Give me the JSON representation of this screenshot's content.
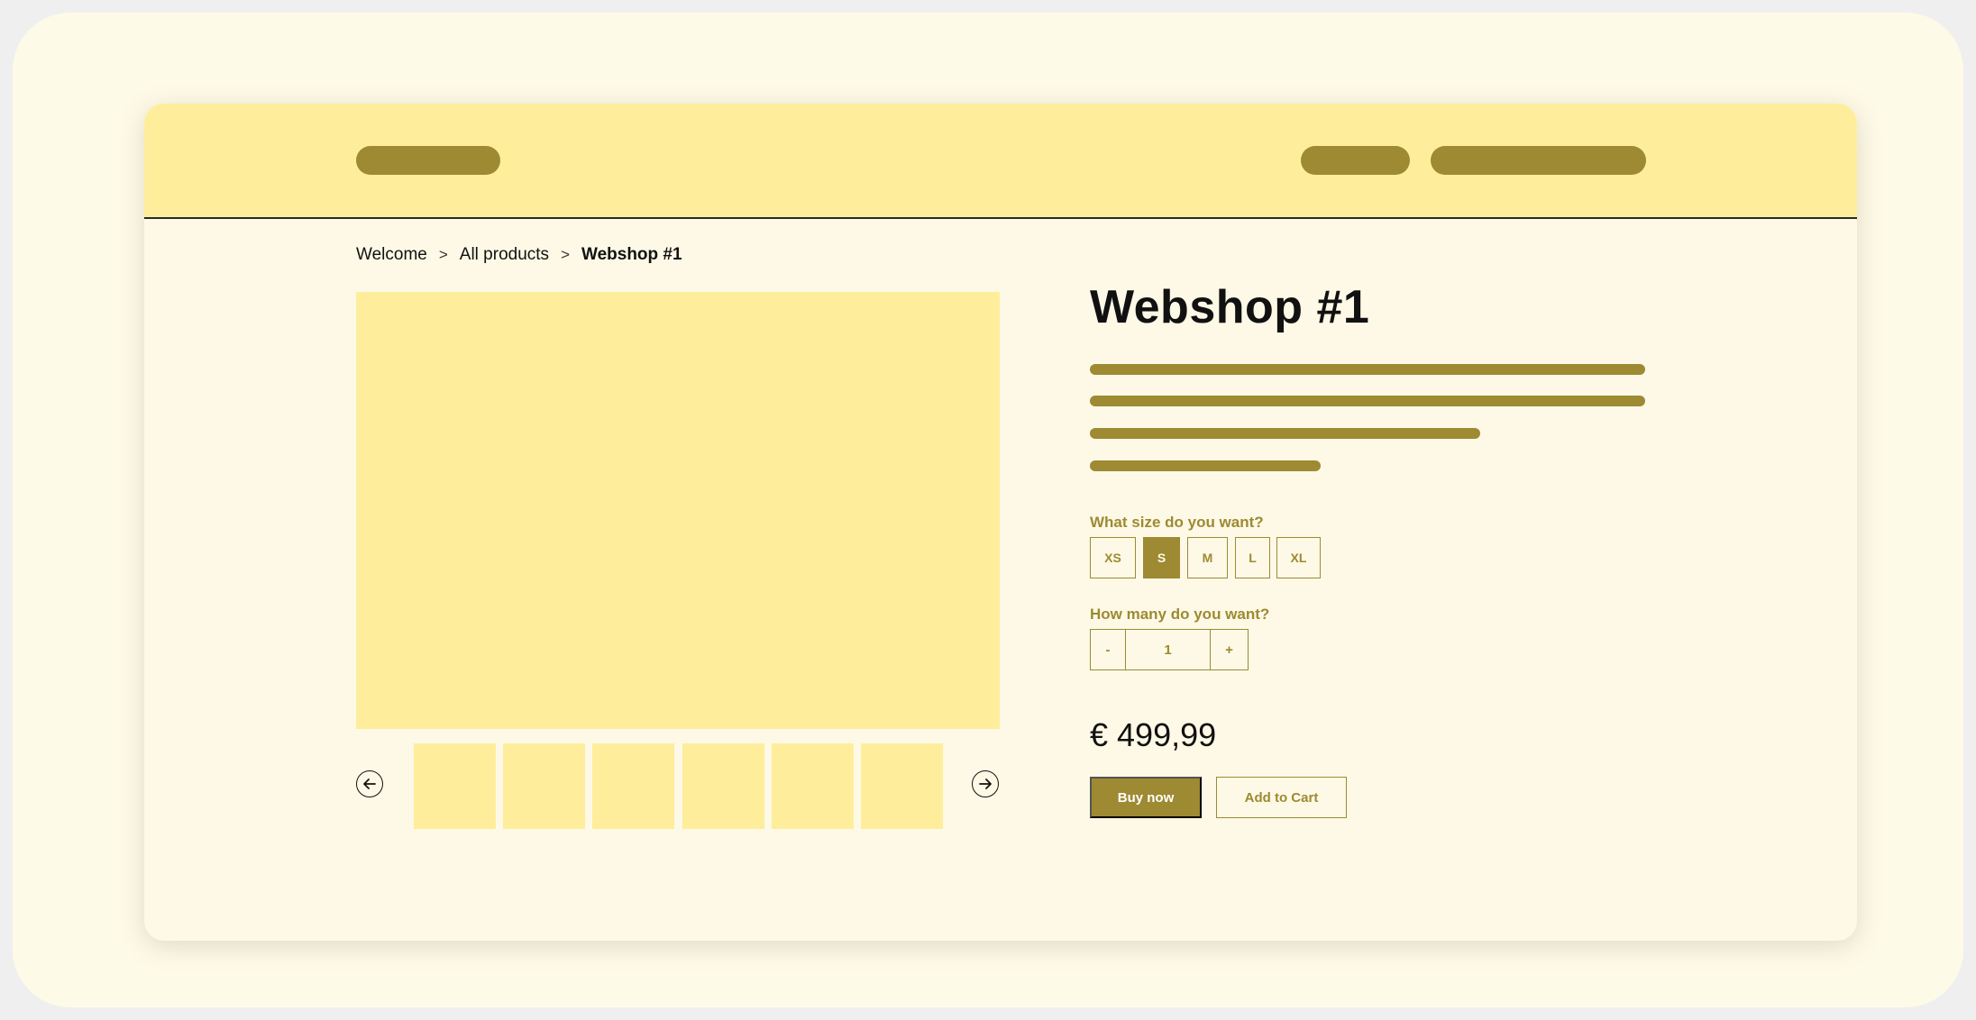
{
  "header": {
    "logo_placeholder": "logo-placeholder",
    "nav_placeholders": [
      "nav-item-placeholder",
      "nav-item-placeholder"
    ],
    "accent_color": "#9d8a32",
    "background_color": "#feee9c"
  },
  "breadcrumb": {
    "items": [
      "Welcome",
      "All products"
    ],
    "current": "Webshop #1",
    "separator": ">"
  },
  "gallery": {
    "prev_icon": "arrow-left-circle-icon",
    "next_icon": "arrow-right-circle-icon",
    "thumbnail_count": 6
  },
  "product": {
    "title": "Webshop #1",
    "size_label": "What size do you want?",
    "sizes": [
      "XS",
      "S",
      "M",
      "L",
      "XL"
    ],
    "selected_size": "S",
    "quantity_label": "How many do you want?",
    "quantity": {
      "minus": "-",
      "value": "1",
      "plus": "+"
    },
    "price": "€ 499,99",
    "buy_now_label": "Buy now",
    "add_to_cart_label": "Add to Cart"
  },
  "colors": {
    "accent": "#9d8a32",
    "surface": "#fdf9e6",
    "highlight": "#feee9c",
    "text": "#111111"
  }
}
